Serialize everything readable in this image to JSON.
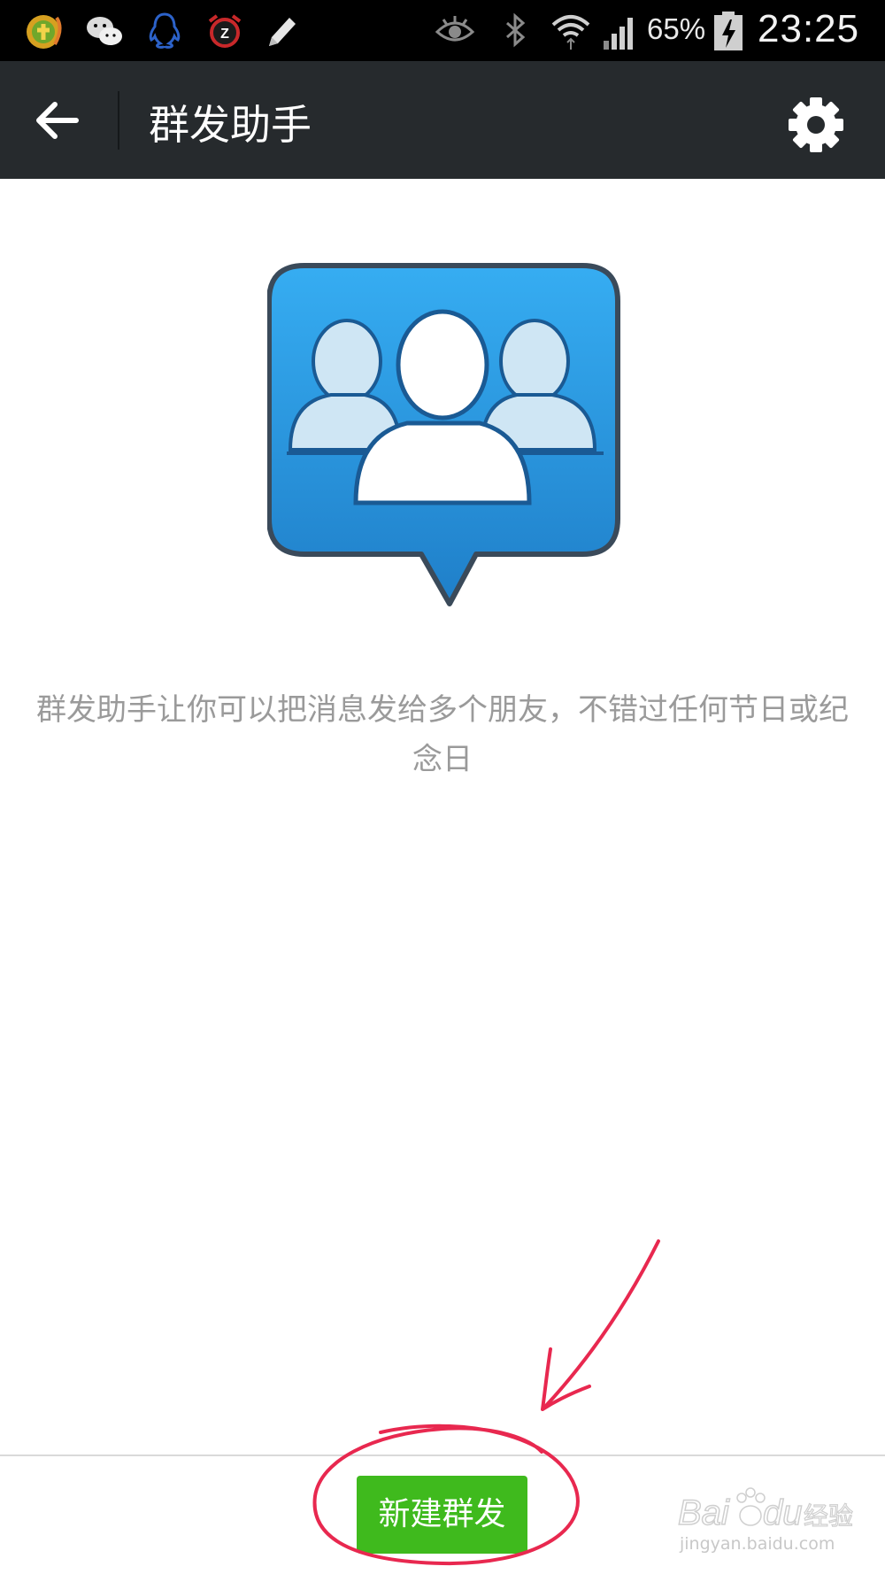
{
  "status_bar": {
    "battery_percent": "65%",
    "time": "23:25",
    "icons": [
      "phone-app-icon",
      "wechat-icon",
      "qq-icon",
      "alarm-icon",
      "pencil-icon",
      "eye-icon",
      "bluetooth-icon",
      "wifi-icon",
      "signal-icon",
      "battery-charging-icon"
    ]
  },
  "action_bar": {
    "title": "群发助手",
    "back_icon": "arrow-left-icon",
    "settings_icon": "gear-icon"
  },
  "main": {
    "illustration_icon": "group-chat-bubble-icon",
    "description": "群发助手让你可以把消息发给多个朋友，不错过任何节日或纪念日"
  },
  "bottom": {
    "new_broadcast_label": "新建群发",
    "button_color": "#3fba1d"
  },
  "watermark": {
    "logo_text": "Baidu 经验",
    "url": "jingyan.baidu.com"
  },
  "colors": {
    "status_bar": "#000000",
    "action_bar": "#262a2d",
    "description_text": "#9a9a9a",
    "annotation": "#e8284f"
  }
}
